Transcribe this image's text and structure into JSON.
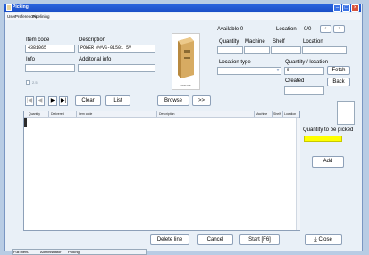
{
  "window": {
    "title": "Picking"
  },
  "menu": [
    "User",
    "Preferences",
    "Pipelining"
  ],
  "item": {
    "code_label": "Item code",
    "code_value": "4381065",
    "desc_label": "Description",
    "desc_value": "POWER ##VS-01501 5V",
    "info_label": "Info",
    "info_value": "",
    "addinfo_label": "Additonal info",
    "addinfo_value": ""
  },
  "checkbox_label": "2.5",
  "image_caption": "4381065",
  "stock": {
    "available_label": "Available 0",
    "location_label": "Location",
    "location_count": "0/0",
    "quantity_label": "Quantity",
    "machine_label": "Machine",
    "shelf_label": "Shelf",
    "location_col_label": "Location",
    "location_type_label": "Location type",
    "qty_per_location_label": "Quantity / location",
    "qty_per_location_value": "5",
    "created_label": "Created",
    "fetch_label": "Fetch",
    "back_label": "Back"
  },
  "nav": {
    "first": "|◀",
    "prev": "◀",
    "next": "▶",
    "last": "▶|"
  },
  "toolbar": {
    "clear": "Clear",
    "list": "List",
    "browse": "Browse",
    "more": ">>"
  },
  "grid": {
    "headers": [
      "Quantity",
      "Delivered",
      "Item code",
      "Description",
      "Machine",
      "Shelf",
      "Location"
    ]
  },
  "right_panel": {
    "qty_to_pick_label": "Quantity to be picked",
    "qty_to_pick_value": "",
    "add_label": "Add",
    "highlight_color": "#ffff00"
  },
  "bottom": {
    "delete_line": "Delete line",
    "cancel": "Cancel",
    "start": "Start [F6]",
    "close": "Close"
  },
  "tabs": [
    "Full menu",
    "Administrator",
    "Picking"
  ]
}
